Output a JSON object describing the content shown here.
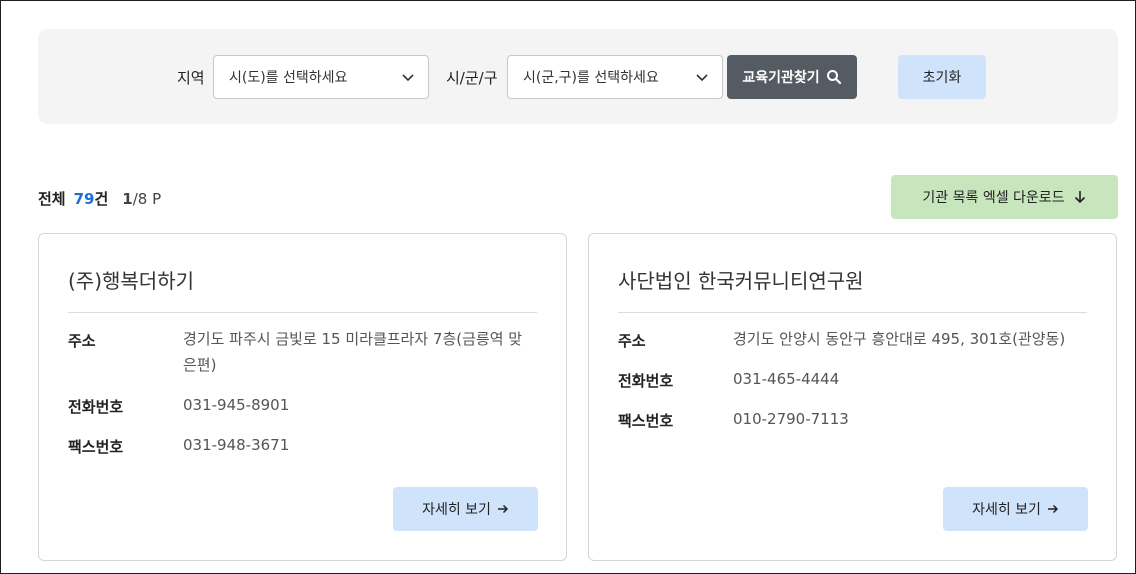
{
  "search": {
    "region_label": "지역",
    "region_placeholder": "시(도)를 선택하세요",
    "district_label": "시/군/구",
    "district_placeholder": "시(군,구)를 선택하세요",
    "find_button": "교육기관찾기",
    "reset_button": "초기화"
  },
  "summary": {
    "total_label": "전체",
    "total_count": "79",
    "count_unit": "건",
    "page_current": "1",
    "page_rest": "/8 P"
  },
  "excel_button": "기관 목록 엑셀 다운로드",
  "cards": [
    {
      "title": "(주)행복더하기",
      "address_label": "주소",
      "address": "경기도 파주시 금빛로 15 미라클프라자 7층(금릉역 맞은편)",
      "phone_label": "전화번호",
      "phone": "031-945-8901",
      "fax_label": "팩스번호",
      "fax": "031-948-3671",
      "detail_button": "자세히 보기"
    },
    {
      "title": "사단법인 한국커뮤니티연구원",
      "address_label": "주소",
      "address": "경기도 안양시 동안구 흥안대로 495, 301호(관양동)",
      "phone_label": "전화번호",
      "phone": "031-465-4444",
      "fax_label": "팩스번호",
      "fax": "010-2790-7113",
      "detail_button": "자세히 보기"
    }
  ],
  "colors": {
    "search_button_bg": "#545b63",
    "light_blue_button": "#cfe3fb",
    "excel_button_bg": "#c8e6bd",
    "count_blue": "#1d6fd6"
  },
  "icons": [
    "chevron-down-icon",
    "search-icon",
    "arrow-down-icon",
    "arrow-right-icon"
  ]
}
